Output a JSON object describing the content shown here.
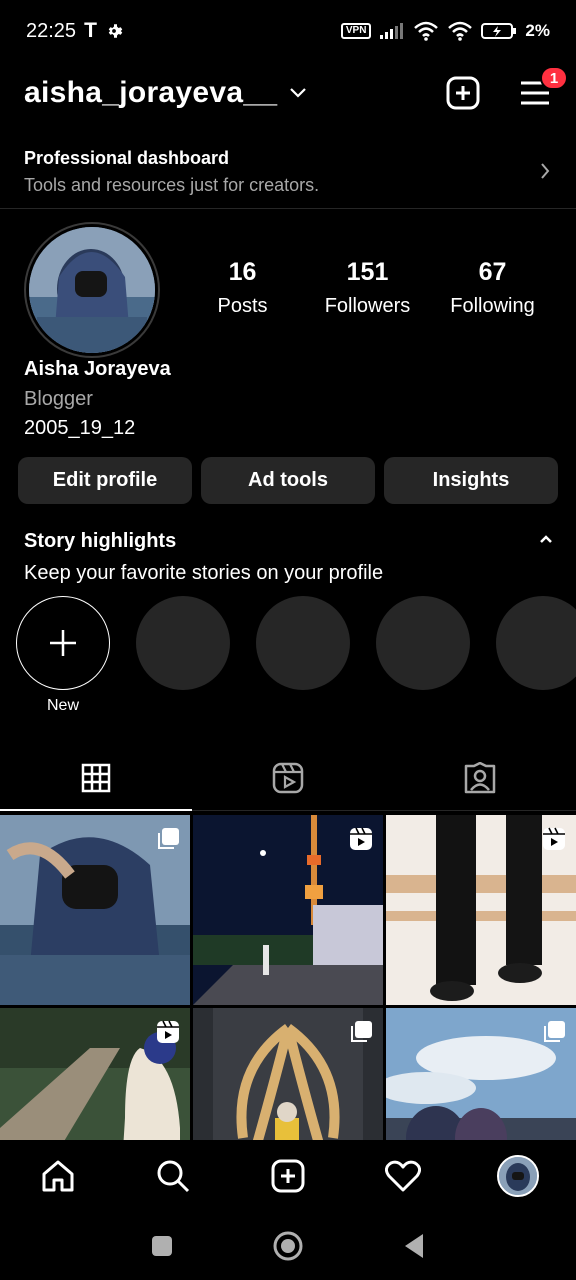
{
  "status_bar": {
    "time": "22:25",
    "carrier_icon": "T",
    "vpn": "VPN",
    "battery": "2%"
  },
  "header": {
    "username": "aisha_jorayeva__",
    "notification_count": "1"
  },
  "dashboard": {
    "title": "Professional dashboard",
    "subtitle": "Tools and resources just for creators."
  },
  "profile": {
    "stats": [
      {
        "num": "16",
        "label": "Posts"
      },
      {
        "num": "151",
        "label": "Followers"
      },
      {
        "num": "67",
        "label": "Following"
      }
    ],
    "name": "Aisha Jorayeva",
    "category": "Blogger",
    "bio": "2005_19_12"
  },
  "actions": {
    "edit": "Edit profile",
    "ad_tools": "Ad tools",
    "insights": "Insights"
  },
  "highlights": {
    "title": "Story highlights",
    "subtitle": "Keep your favorite stories on your profile",
    "new_label": "New"
  },
  "colors": {
    "background": "#000000",
    "button_bg": "#262626",
    "badge_red": "#ff3040",
    "secondary_text": "#a8a8a8"
  },
  "icons": [
    "settings-icon",
    "wifi-icon",
    "signal-icon",
    "battery-icon",
    "chevron-down-icon",
    "new-post-icon",
    "menu-icon",
    "chevron-right-icon",
    "chevron-up-icon",
    "plus-icon",
    "grid-icon",
    "reels-icon",
    "tagged-icon",
    "carousel-icon",
    "reel-icon",
    "home-icon",
    "search-icon",
    "create-icon",
    "heart-icon"
  ]
}
